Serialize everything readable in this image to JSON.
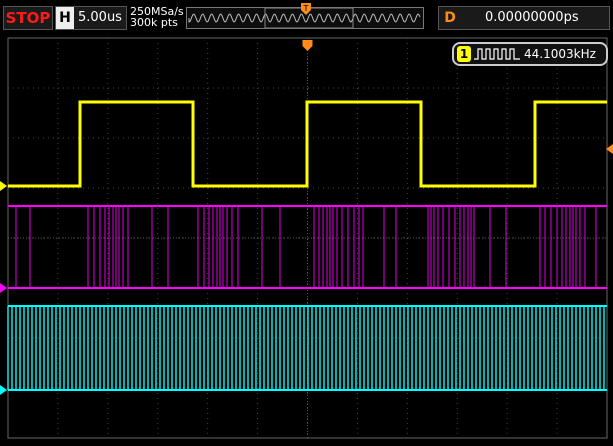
{
  "run_state": "STOP",
  "horizontal": {
    "label": "H",
    "value": "5.00us"
  },
  "acquisition": {
    "sample_rate": "250MSa/s",
    "memory_depth": "300k pts"
  },
  "trigger_marker": "T",
  "delay": {
    "label": "D",
    "value": "0.00000000ps"
  },
  "measurement": {
    "channel": "1",
    "value": "44.1003kHz"
  },
  "colors": {
    "ch1": "#ffff00",
    "ch2": "#ff00ff",
    "ch3": "#00ffff",
    "trigger": "#ff8c1a",
    "stop": "#ff1a1a"
  }
}
